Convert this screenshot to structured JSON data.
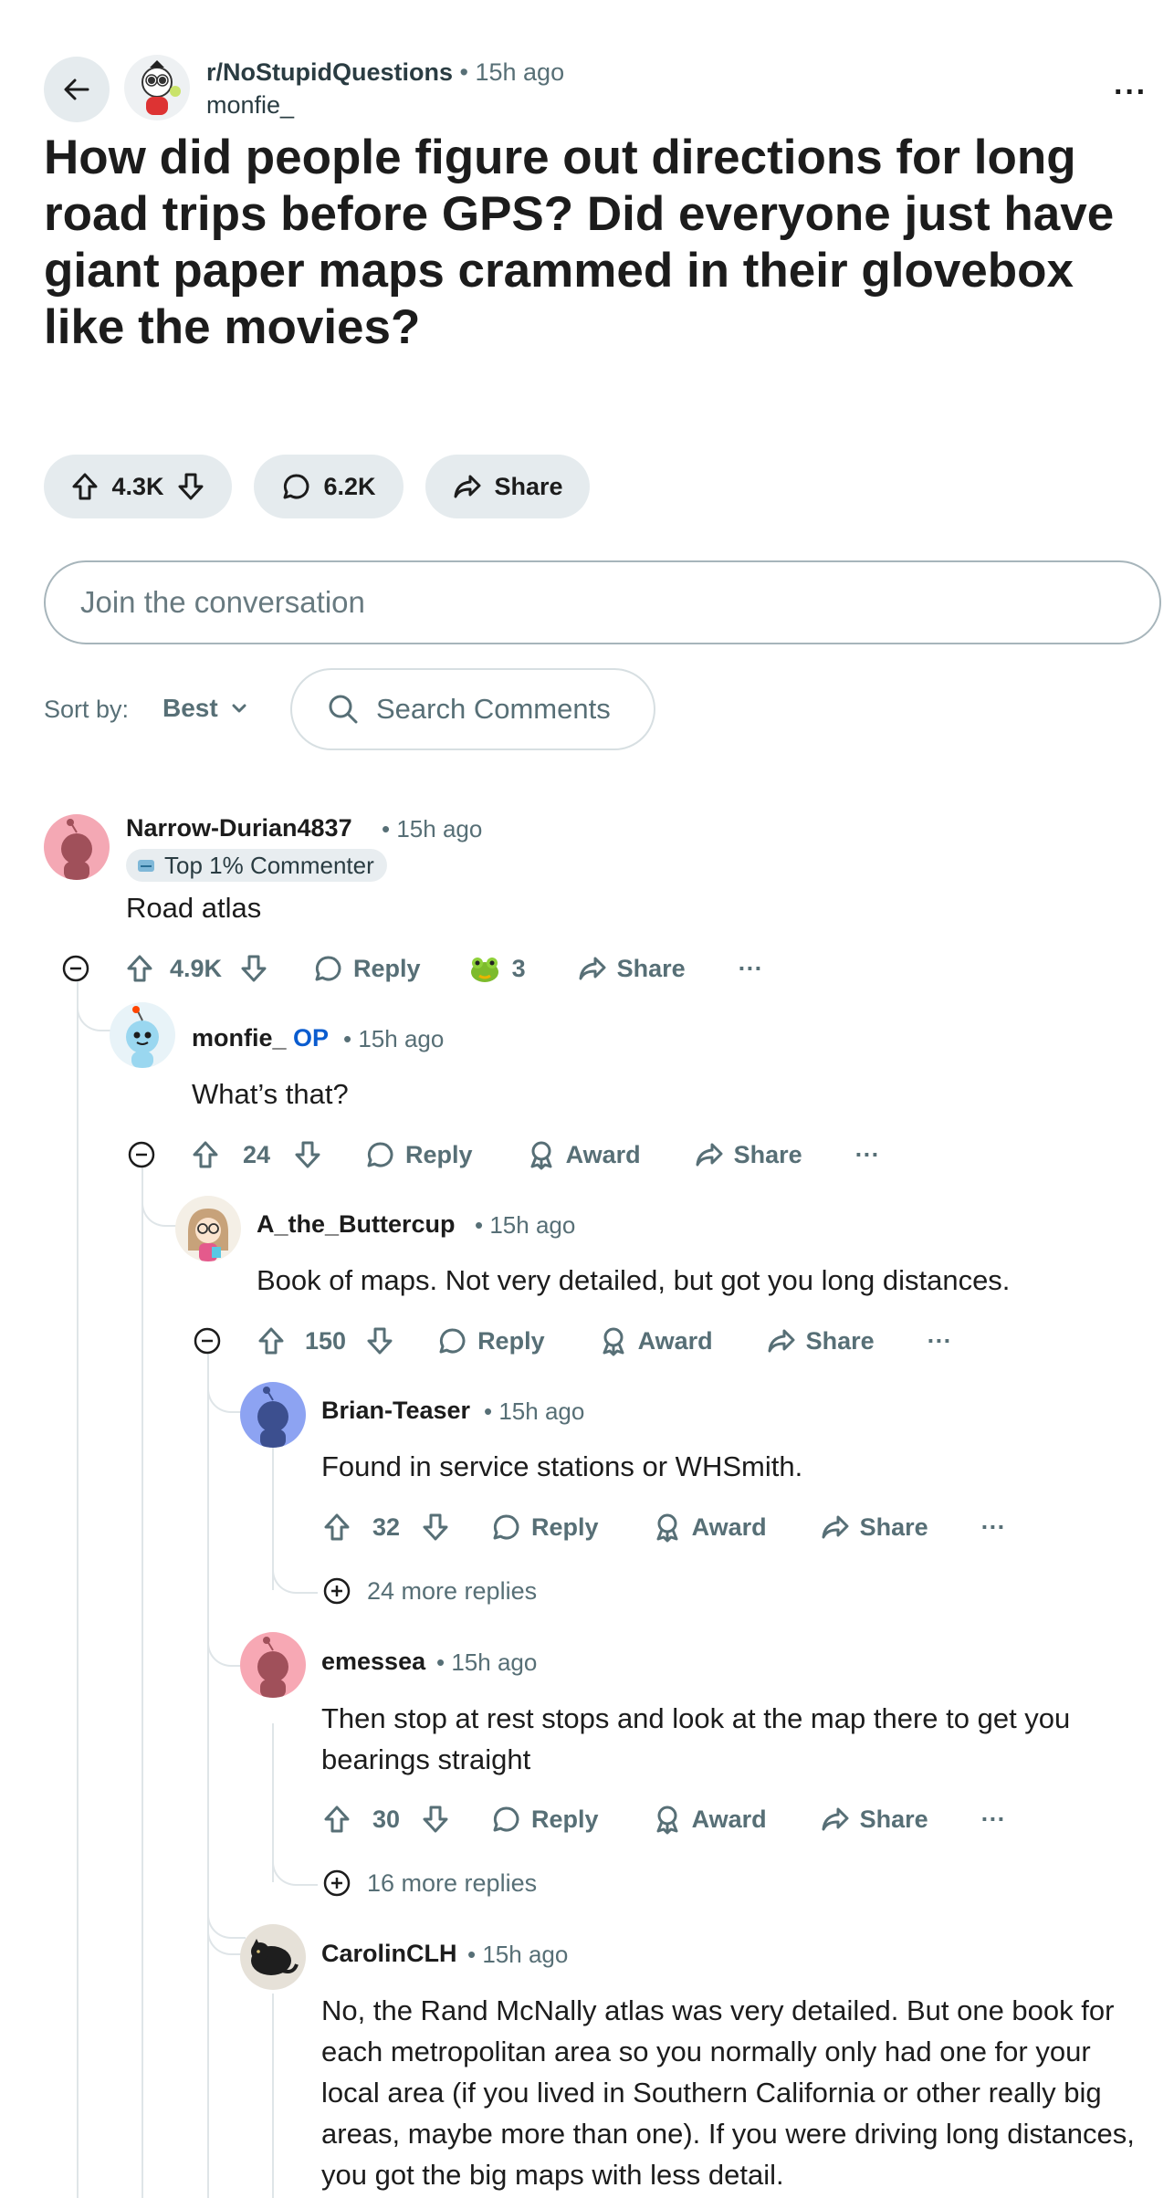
{
  "header": {
    "subreddit": "r/NoStupidQuestions",
    "dot": "•",
    "time": "15h ago",
    "author": "monfie_",
    "more": "···"
  },
  "post": {
    "title": "How did people figure out directions for long road trips before GPS? Did everyone just have giant paper maps crammed in their glovebox like the movies?",
    "votes": "4.3K",
    "comments": "6.2K",
    "share": "Share"
  },
  "composer": {
    "placeholder": "Join the conversation"
  },
  "sort": {
    "label": "Sort by:",
    "value": "Best",
    "search_placeholder": "Search Comments"
  },
  "labels": {
    "reply": "Reply",
    "award": "Award",
    "share": "Share",
    "more": "···",
    "dot": "•",
    "op": "OP"
  },
  "comments": [
    {
      "user": "Narrow-Durian4837",
      "time": "15h ago",
      "badge": "Top 1% Commenter",
      "text": "Road atlas",
      "votes": "4.9K",
      "awards": "3"
    },
    {
      "user": "monfie_",
      "time": "15h ago",
      "text": "What’s that?",
      "votes": "24"
    },
    {
      "user": "A_the_Buttercup",
      "time": "15h ago",
      "text": "Book of maps. Not very detailed, but got you long distances.",
      "votes": "150"
    },
    {
      "user": "Brian-Teaser",
      "time": "15h ago",
      "text": "Found in service stations or WHSmith.",
      "votes": "32",
      "more_replies": "24 more replies"
    },
    {
      "user": "emessea",
      "time": "15h ago",
      "text": "Then stop at rest stops and look at the map there to get you bearings straight",
      "votes": "30",
      "more_replies": "16 more replies"
    },
    {
      "user": "CarolinCLH",
      "time": "15h ago",
      "text": "No, the Rand McNally atlas was very detailed. But one book for each metropolitan area so you normally only had one for your local area (if you lived in Southern California or other really big areas, maybe more than one). If you were driving long distances, you got the big maps with less detail."
    }
  ],
  "colors": {
    "accent_op": "#0a5ccf",
    "pill_bg": "#e5ebee",
    "meta": "#576f76",
    "thread_line": "#dfe5e8"
  }
}
